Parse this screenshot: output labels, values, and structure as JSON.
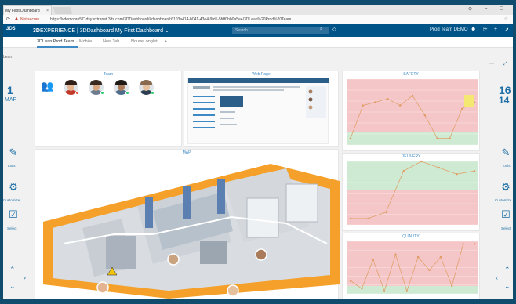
{
  "browser": {
    "tab_title": "My First Dashboard",
    "tab_close": "×",
    "not_secure": "Not secure",
    "url": "https://vdemopro571dsy.extranet.3ds.com/3DDashboard/#dashboard:6103a414-b041-43e4-9fd1-5fdf0bb0a5e4/3DLean%20Prod%20Team",
    "window_controls": [
      "⊖",
      "–",
      "☐"
    ]
  },
  "header": {
    "brand_bold": "3D",
    "brand_text": "EXPERIENCE | 3DDashboard My First Dashboard ⌄",
    "search_placeholder": "Search",
    "user_label": "Prod Team DEMO"
  },
  "tabs": [
    {
      "label": "3DLean Prod Team ⌄",
      "active": true
    },
    {
      "label": "Mobile",
      "active": false
    },
    {
      "label": "New Tab",
      "active": false
    },
    {
      "label": "Nouvel onglet",
      "active": false
    },
    {
      "label": "+",
      "active": false
    }
  ],
  "sidebar_left": {
    "app_label": "Lean",
    "date_day": "1",
    "date_month": "MAR",
    "tools_label": "Tools",
    "customize_label": "Customize",
    "select_label": "Select"
  },
  "sidebar_right": {
    "date_day": "16",
    "date_day2": "14",
    "tools_label": "Tools",
    "customize_label": "Customize",
    "select_label": "Select"
  },
  "panels": {
    "team_title": "Team",
    "webpage_title": "Web Page",
    "safety_title": "SAFETY",
    "delivery_title": "DELIVERY",
    "quality_title": "QUALITY",
    "map_title": "MAP"
  },
  "team_members": [
    {
      "status": "#e74c3c",
      "skin": "#e4b390",
      "hair": "#2f1f16",
      "shirt": "#c0392b"
    },
    {
      "status": "#2ecc71",
      "skin": "#d8a880",
      "hair": "#3a2a20",
      "shirt": "#6b7c8f"
    },
    {
      "status": "#2ecc71",
      "skin": "#a97b5a",
      "hair": "#1f1a16",
      "shirt": "#4f6d8a"
    },
    {
      "status": "#2ecc71",
      "skin": "#e6c1a0",
      "hair": "#8a6a4f",
      "shirt": "#2c3e50"
    }
  ],
  "charts": {
    "band_colors": {
      "green": "#cfead3",
      "red": "#f4c6c8",
      "line": "#e0a16a",
      "point": "#e09a60",
      "point_green": "#5fae6a"
    },
    "safety": {
      "values": [
        0.1,
        0.6,
        0.65,
        0.7,
        0.6,
        0.75,
        0.45,
        0.1,
        0.1,
        0.55,
        0.65
      ]
    },
    "delivery": {
      "values": [
        0.1,
        0.1,
        0.2,
        0.85,
        1.0,
        0.9,
        0.8,
        0.85
      ]
    },
    "quality": {
      "values": [
        0.25,
        0.1,
        0.65,
        0.05,
        0.75,
        0.05,
        0.7,
        0.45,
        0.7,
        0.15,
        0.95,
        0.95
      ]
    }
  }
}
